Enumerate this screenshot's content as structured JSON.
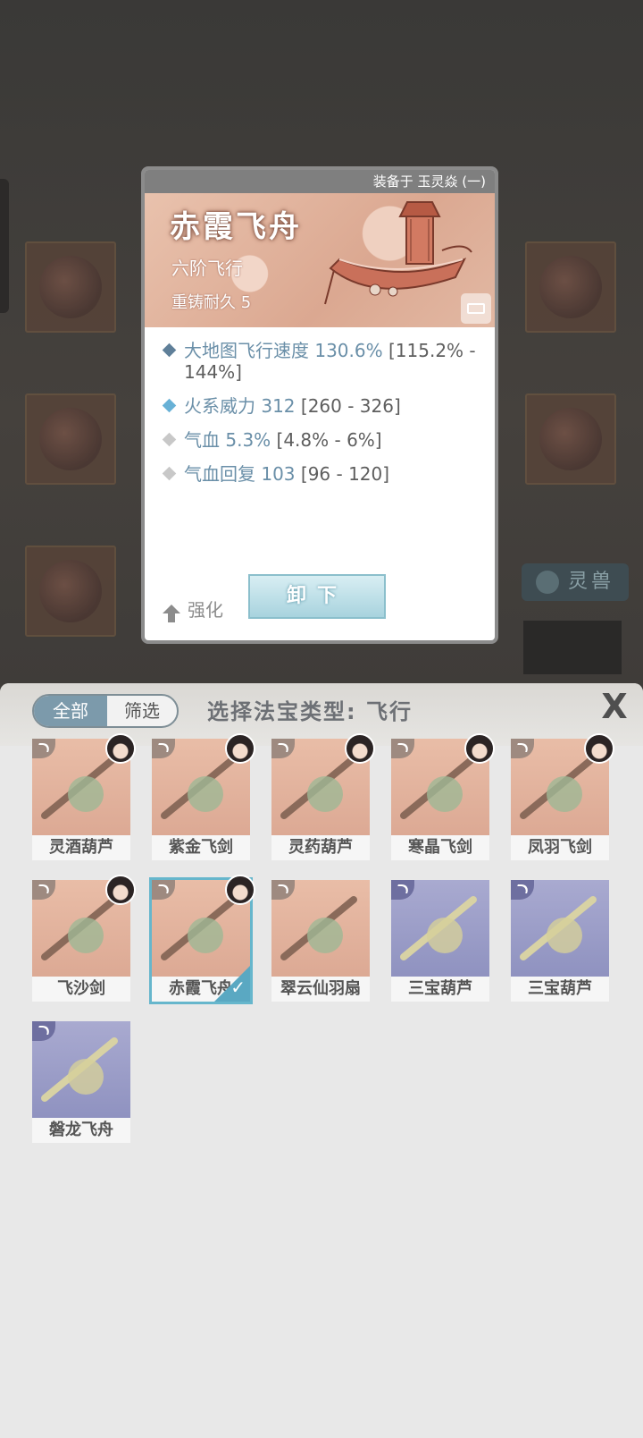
{
  "popup": {
    "equipped_on": "装备于 玉灵焱 (一)",
    "name": "赤霞飞舟",
    "grade": "六阶飞行",
    "durability": "重铸耐久 5",
    "stats": [
      {
        "main": "大地图飞行速度 130.6%",
        "range": " [115.2% - 144%]",
        "color": "#5f7f99"
      },
      {
        "main": "火系威力 312",
        "range": " [260 - 326]",
        "color": "#68b1d6"
      },
      {
        "main": "气血 5.3%",
        "range": " [4.8% - 6%]",
        "color": "#c8c8c8"
      },
      {
        "main": "气血回复 103",
        "range": " [96 - 120]",
        "color": "#c8c8c8"
      }
    ],
    "enhance_label": "强化",
    "unequip_label": "卸下"
  },
  "background": {
    "lingshou_label": "灵兽"
  },
  "panel": {
    "tab_all": "全部",
    "tab_filter": "筛选",
    "title": "选择法宝类型: 飞行",
    "close": "X",
    "items": [
      {
        "label": "灵酒葫芦",
        "avatar": true,
        "purple": false,
        "selected": false
      },
      {
        "label": "紫金飞剑",
        "avatar": true,
        "purple": false,
        "selected": false
      },
      {
        "label": "灵药葫芦",
        "avatar": true,
        "purple": false,
        "selected": false
      },
      {
        "label": "寒晶飞剑",
        "avatar": true,
        "purple": false,
        "selected": false
      },
      {
        "label": "凤羽飞剑",
        "avatar": true,
        "purple": false,
        "selected": false
      },
      {
        "label": "飞沙剑",
        "avatar": true,
        "purple": false,
        "selected": false
      },
      {
        "label": "赤霞飞舟",
        "avatar": true,
        "purple": false,
        "selected": true
      },
      {
        "label": "翠云仙羽扇",
        "avatar": false,
        "purple": false,
        "selected": false
      },
      {
        "label": "三宝葫芦",
        "avatar": false,
        "purple": true,
        "selected": false
      },
      {
        "label": "三宝葫芦",
        "avatar": false,
        "purple": true,
        "selected": false
      },
      {
        "label": "磐龙飞舟",
        "avatar": false,
        "purple": true,
        "selected": false
      }
    ]
  },
  "colors": {
    "accent": "#66b6cc",
    "stat_value": "#6a8fa8"
  }
}
